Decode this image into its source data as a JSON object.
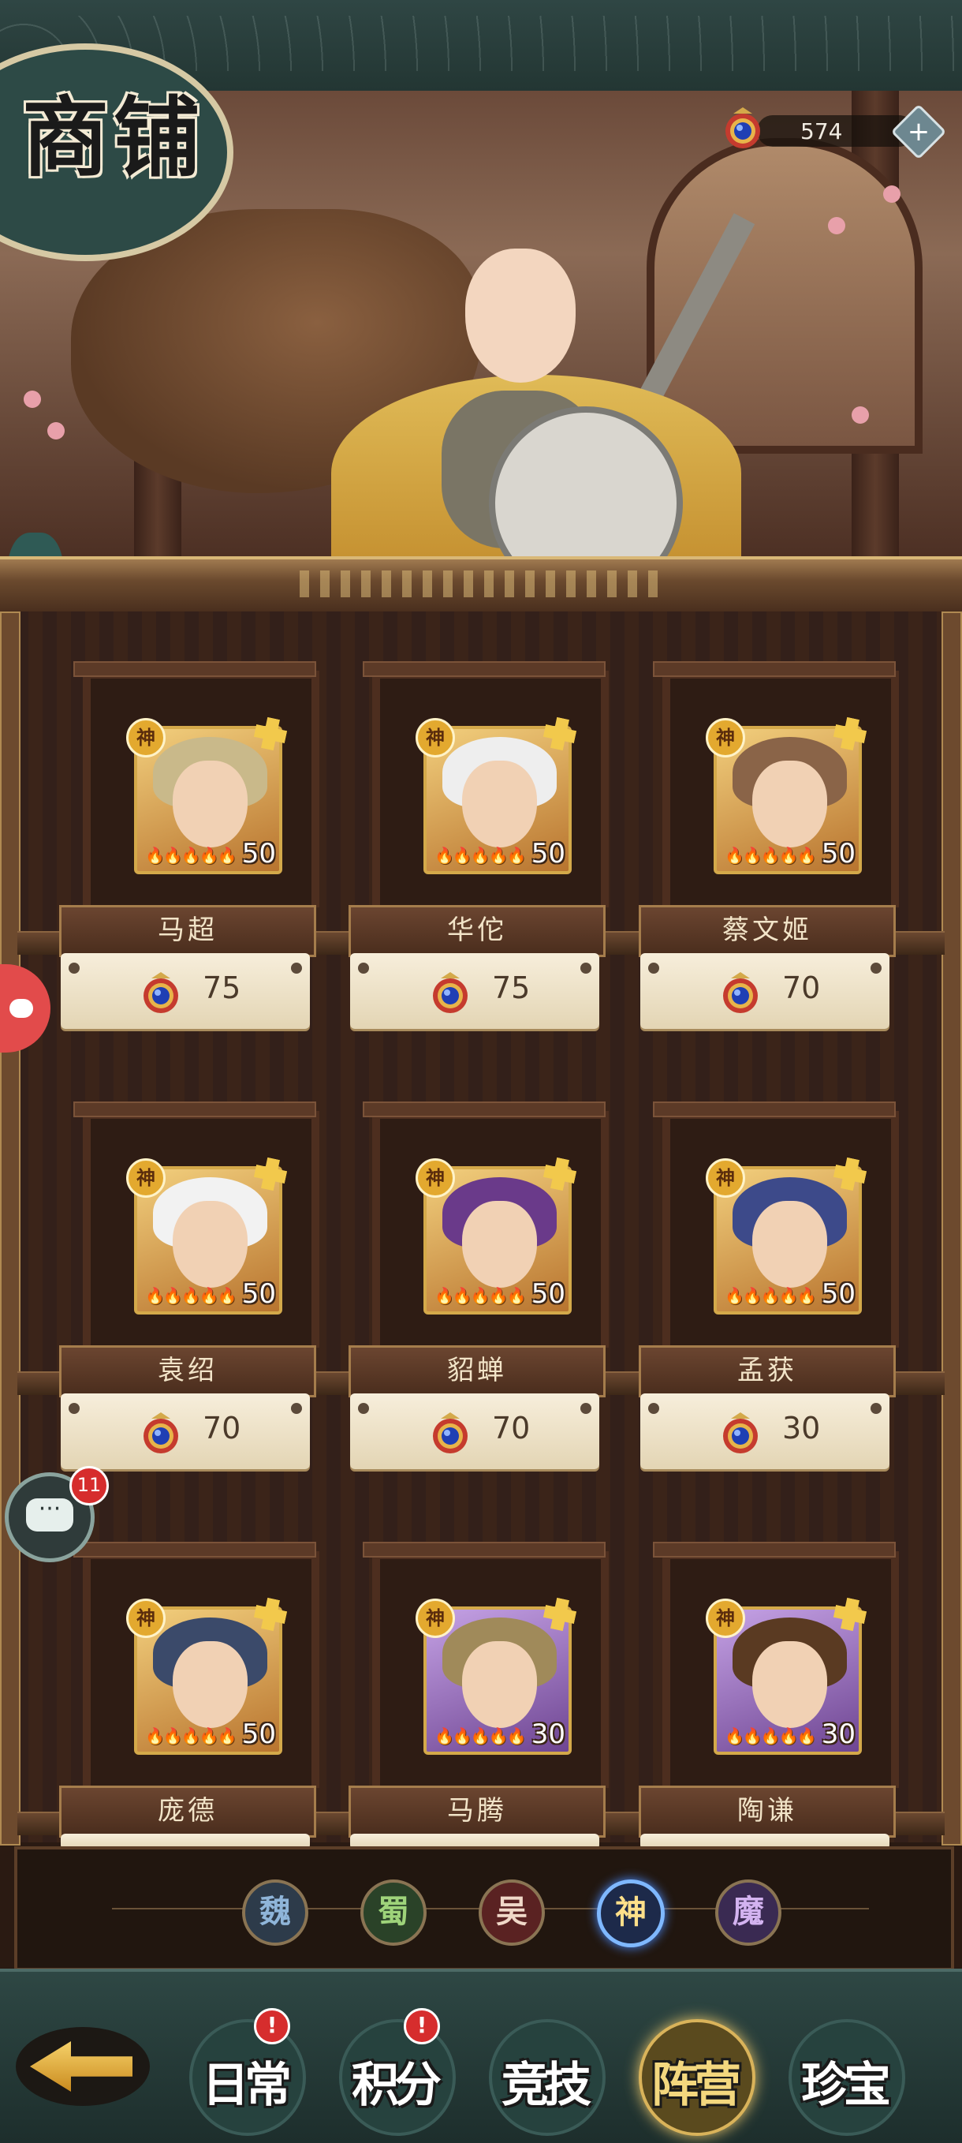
{
  "header": {
    "title": "商铺"
  },
  "currency": {
    "amount": "574",
    "icon": "gem-icon",
    "add_label": "+"
  },
  "shop": {
    "items": [
      {
        "name": "马超",
        "price": "75",
        "level": "50",
        "badge": "神",
        "frame": "gold"
      },
      {
        "name": "华佗",
        "price": "75",
        "level": "50",
        "badge": "神",
        "frame": "gold"
      },
      {
        "name": "蔡文姬",
        "price": "70",
        "level": "50",
        "badge": "神",
        "frame": "gold"
      },
      {
        "name": "袁绍",
        "price": "70",
        "level": "50",
        "badge": "神",
        "frame": "gold"
      },
      {
        "name": "貂蝉",
        "price": "70",
        "level": "50",
        "badge": "神",
        "frame": "gold"
      },
      {
        "name": "孟获",
        "price": "30",
        "level": "50",
        "badge": "神",
        "frame": "gold"
      },
      {
        "name": "庞德",
        "price": "",
        "level": "50",
        "badge": "神",
        "frame": "gold"
      },
      {
        "name": "马腾",
        "price": "",
        "level": "30",
        "badge": "神",
        "frame": "purple"
      },
      {
        "name": "陶谦",
        "price": "",
        "level": "30",
        "badge": "神",
        "frame": "purple"
      }
    ]
  },
  "factions": [
    {
      "label": "魏",
      "color": "#8fb5d9",
      "bg": "#2d3b4a",
      "active": false
    },
    {
      "label": "蜀",
      "color": "#9ed37a",
      "bg": "#2a4228",
      "active": false
    },
    {
      "label": "吴",
      "color": "#f0d8c8",
      "bg": "#5a2222",
      "active": false
    },
    {
      "label": "神",
      "color": "#ffe08a",
      "bg": "#1d2a4a",
      "active": true
    },
    {
      "label": "魔",
      "color": "#d3b3f0",
      "bg": "#3a2a52",
      "active": false
    }
  ],
  "nav": {
    "back_icon": "back-arrow-icon",
    "tabs": [
      {
        "label": "日常",
        "alert": "!",
        "active": false
      },
      {
        "label": "积分",
        "alert": "!",
        "active": false
      },
      {
        "label": "竞技",
        "alert": "",
        "active": false
      },
      {
        "label": "阵营",
        "alert": "",
        "active": true
      },
      {
        "label": "珍宝",
        "alert": "",
        "active": false
      }
    ]
  },
  "chat": {
    "unread": "11"
  },
  "colors": {
    "accent": "#d9b35a",
    "alert": "#d62d2d",
    "price_text": "#4b3a2a"
  }
}
